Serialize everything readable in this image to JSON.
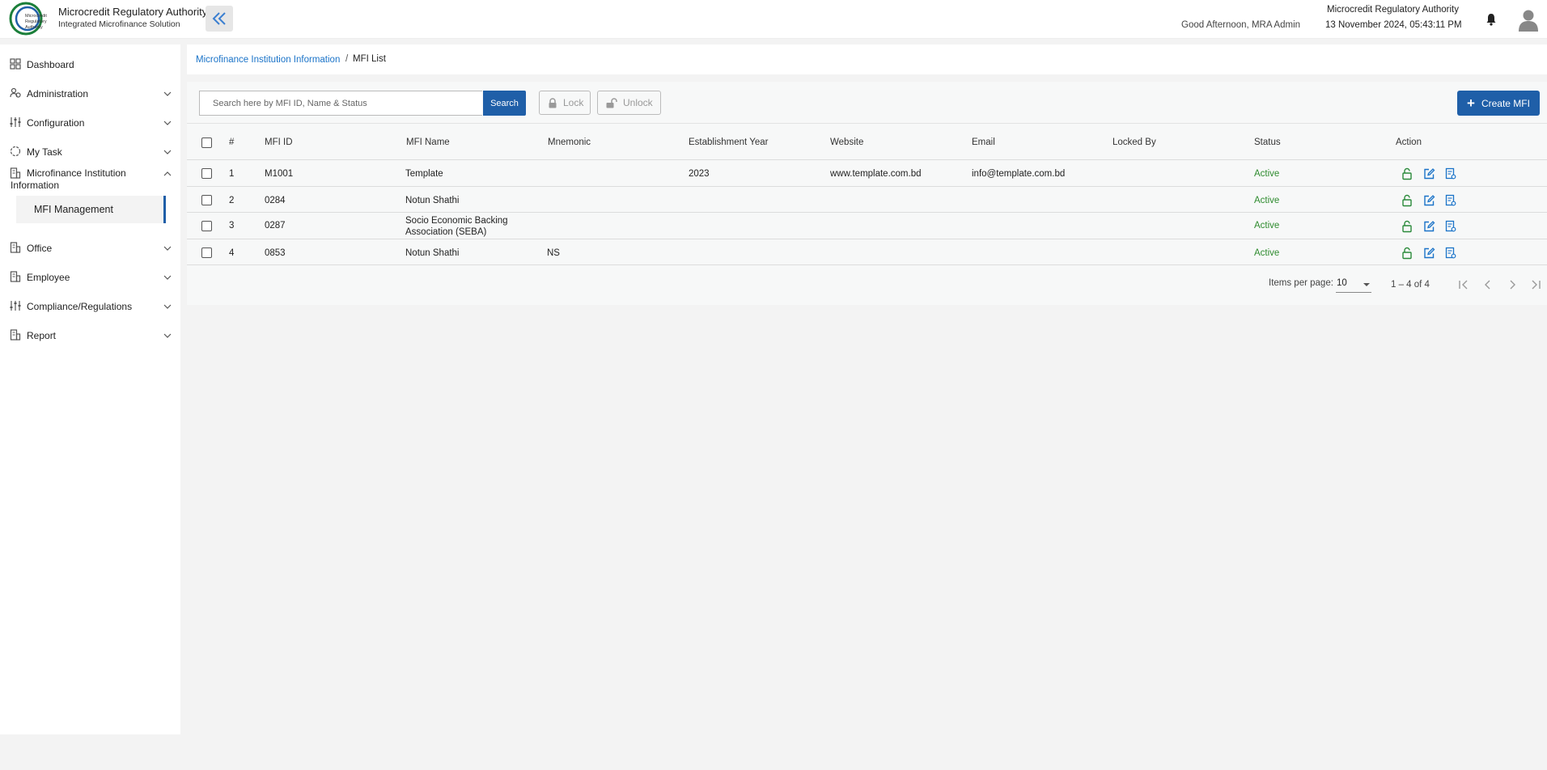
{
  "header": {
    "logo_text": "Microcredit Regulatory Authority",
    "title": "Microcredit Regulatory Authority",
    "subtitle": "Integrated Microfinance Solution",
    "greeting": "Good Afternoon, MRA Admin",
    "org_name": "Microcredit Regulatory Authority",
    "datetime": "13 November 2024, 05:43:11 PM"
  },
  "sidebar": {
    "items": [
      {
        "label": "Dashboard",
        "icon": "grid-icon"
      },
      {
        "label": "Administration",
        "icon": "users-icon"
      },
      {
        "label": "Configuration",
        "icon": "sliders-icon"
      },
      {
        "label": "My Task",
        "icon": "task-icon"
      },
      {
        "label": "Microfinance Institution Information",
        "icon": "building-icon"
      },
      {
        "label": "Office",
        "icon": "building-icon"
      },
      {
        "label": "Employee",
        "icon": "building-icon"
      },
      {
        "label": "Compliance/Regulations",
        "icon": "sliders-icon"
      },
      {
        "label": "Report",
        "icon": "building-icon"
      }
    ],
    "sub_item": "MFI Management"
  },
  "breadcrumb": {
    "parent": "Microfinance Institution Information",
    "separator": "/",
    "current": "MFI List"
  },
  "toolbar": {
    "search_placeholder": "Search here by MFI ID, Name & Status",
    "search_label": "Search",
    "lock_label": "Lock",
    "unlock_label": "Unlock",
    "create_label": "Create MFI"
  },
  "table": {
    "columns": [
      "#",
      "MFI ID",
      "MFI Name",
      "Mnemonic",
      "Establishment Year",
      "Website",
      "Email",
      "Locked By",
      "Status",
      "Action"
    ],
    "rows": [
      {
        "num": "1",
        "id": "M1001",
        "name": "Template",
        "mnemonic": "",
        "year": "2023",
        "website": "www.template.com.bd",
        "email": "info@template.com.bd",
        "locked_by": "",
        "status": "Active"
      },
      {
        "num": "2",
        "id": "0284",
        "name": "Notun Shathi",
        "mnemonic": "",
        "year": "",
        "website": "",
        "email": "",
        "locked_by": "",
        "status": "Active"
      },
      {
        "num": "3",
        "id": "0287",
        "name": "Socio Economic Backing Association (SEBA)",
        "mnemonic": "",
        "year": "",
        "website": "",
        "email": "",
        "locked_by": "",
        "status": "Active"
      },
      {
        "num": "4",
        "id": "0853",
        "name": "Notun Shathi",
        "mnemonic": "NS",
        "year": "",
        "website": "",
        "email": "",
        "locked_by": "",
        "status": "Active"
      }
    ]
  },
  "paginator": {
    "items_per_page_label": "Items per page:",
    "page_size": "10",
    "range": "1 – 4 of 4"
  },
  "colors": {
    "primary": "#1f5fa8",
    "link": "#1a73c8",
    "status_active": "#2e8b2e",
    "action_icon": "#2a8a3a"
  }
}
